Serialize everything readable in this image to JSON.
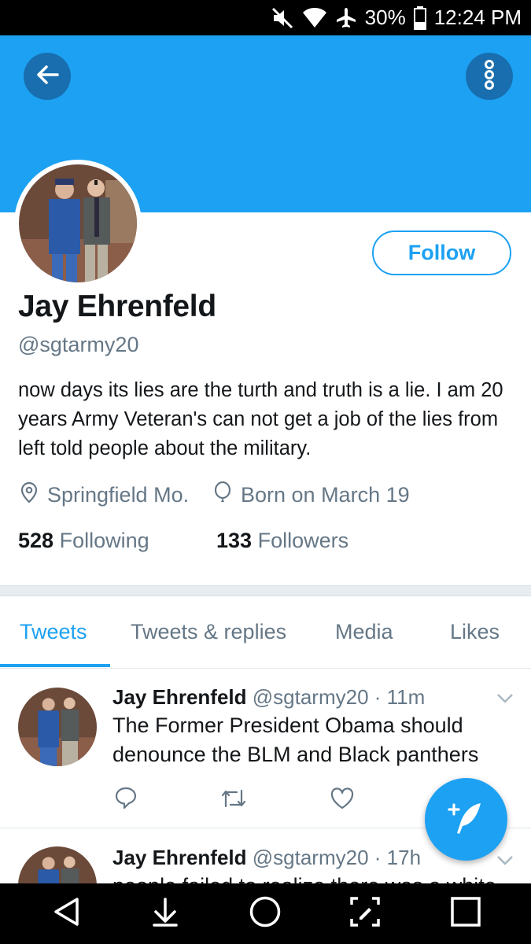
{
  "status_bar": {
    "battery": "30%",
    "time": "12:24 PM"
  },
  "profile": {
    "name": "Jay Ehrenfeld",
    "handle": "@sgtarmy20",
    "bio": "now days its lies are the turth and truth is a lie.  I am 20 years Army Veteran's can not get a job  of the lies from left told people about the military.",
    "location": "Springfield Mo.",
    "birthday": "Born on March 19",
    "following_count": "528",
    "following_label": "Following",
    "followers_count": "133",
    "followers_label": "Followers",
    "follow_label": "Follow"
  },
  "tabs": [
    "Tweets",
    "Tweets & replies",
    "Media",
    "Likes"
  ],
  "tweets": [
    {
      "name": "Jay Ehrenfeld",
      "handle": "@sgtarmy20",
      "time": "· 11m",
      "text": "The Former President Obama should denounce  the BLM and Black panthers"
    },
    {
      "name": "Jay Ehrenfeld",
      "handle": "@sgtarmy20",
      "time": "· 17h",
      "text": "people failed to realize there was a white"
    }
  ],
  "colors": {
    "accent": "#1da1f2",
    "muted": "#657786",
    "text": "#14171a"
  }
}
